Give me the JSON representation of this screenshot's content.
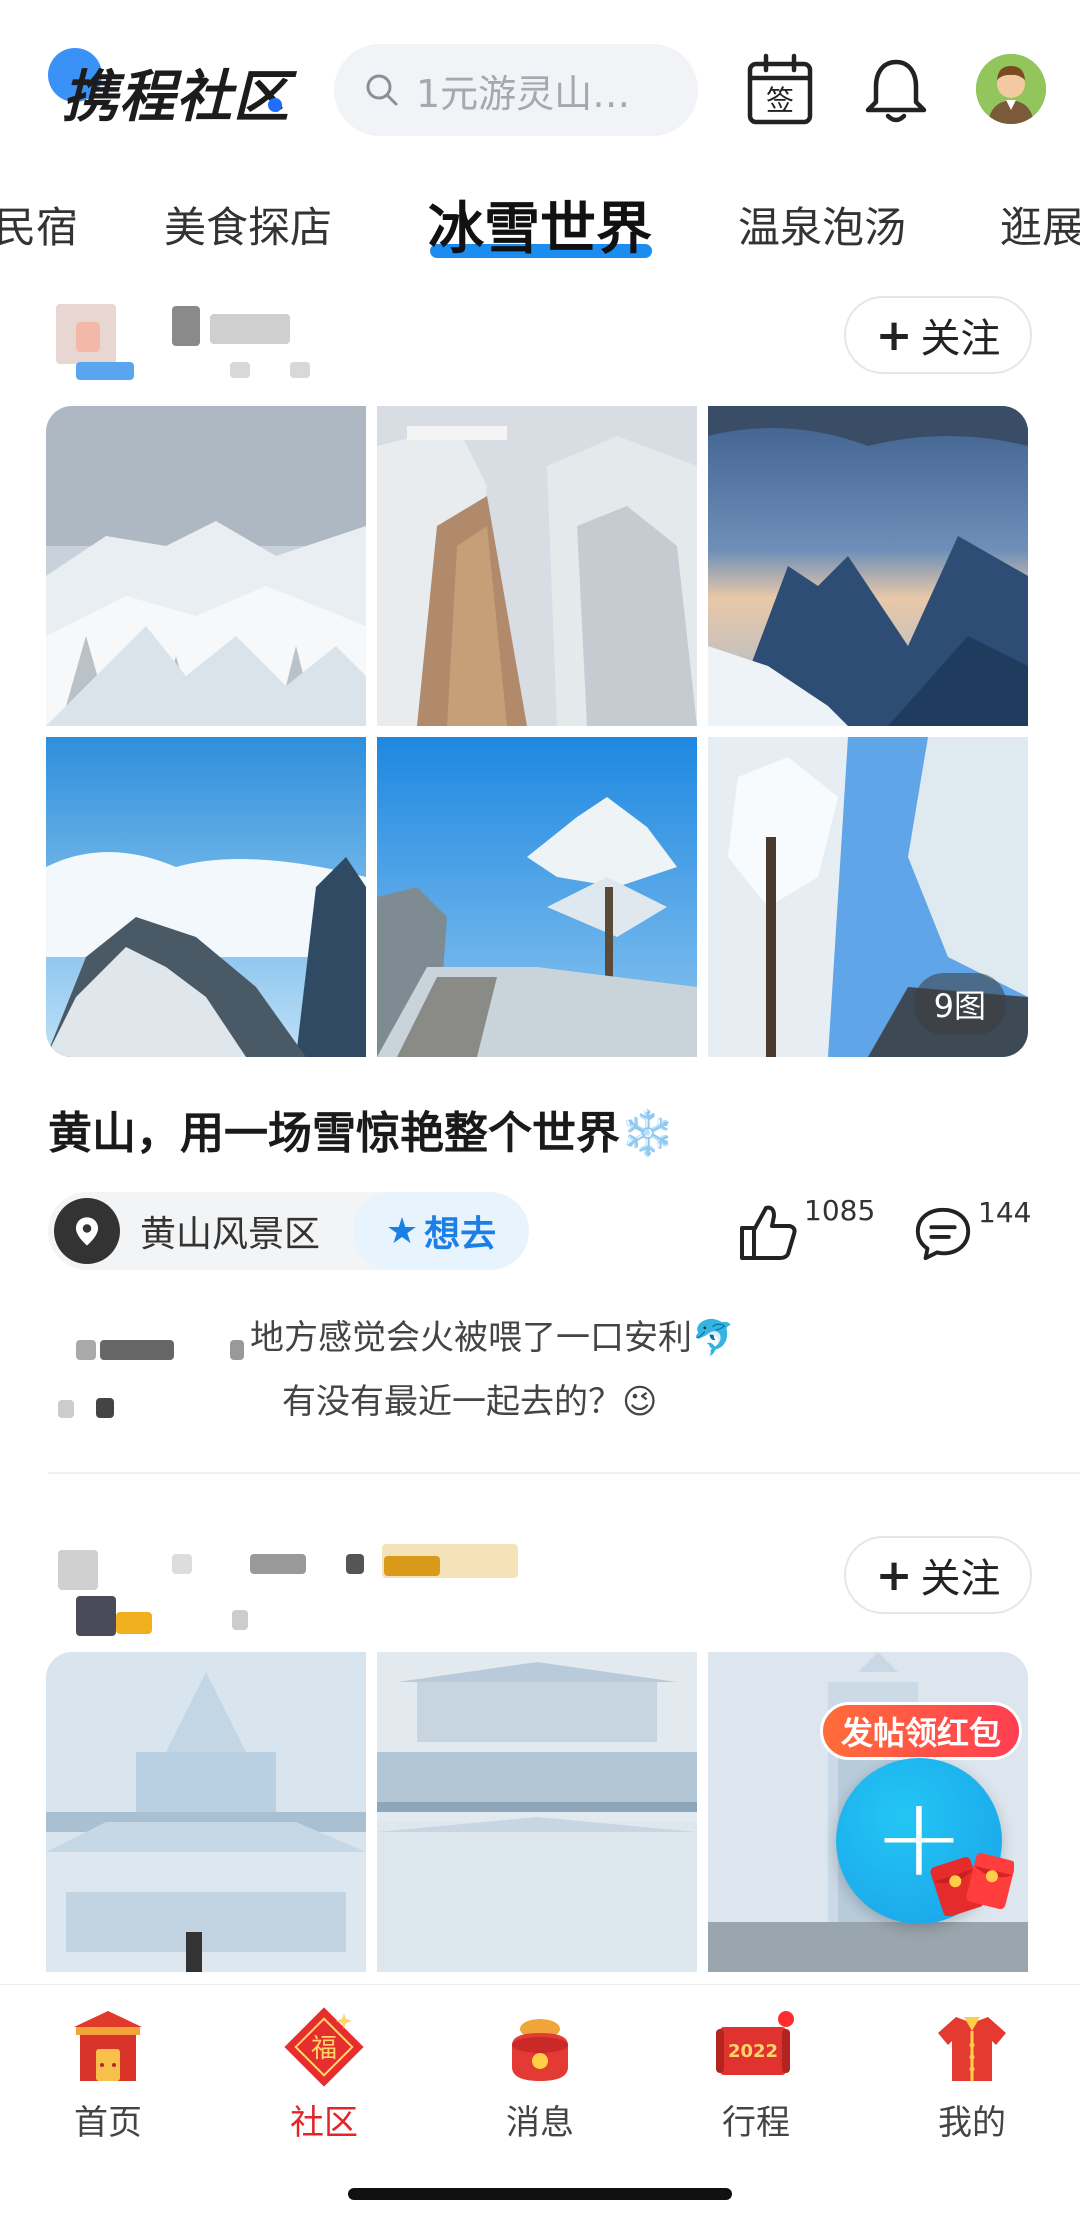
{
  "header": {
    "logo": "携程社区",
    "search_placeholder": "1元游灵山…",
    "sign_icon_text": "签"
  },
  "tabs": [
    "民宿",
    "美食探店",
    "冰雪世界",
    "温泉泡汤",
    "逛展"
  ],
  "active_tab": "冰雪世界",
  "post1": {
    "follow_label": "关注",
    "image_count": "9图",
    "title": "黄山，用一场雪惊艳整个世界❄️",
    "location": "黄山风景区",
    "want_label": "想去",
    "likes": "1085",
    "comments": "144",
    "comment_line1": "地方感觉会火被喂了一口安利🐬",
    "comment_line2": "有没有最近一起去的？😉"
  },
  "post2": {
    "follow_label": "关注"
  },
  "fab": {
    "tag": "发帖领红包",
    "plus": "+"
  },
  "bottom_nav": [
    {
      "label": "首页",
      "icon": "home-gate-icon",
      "active": false
    },
    {
      "label": "社区",
      "icon": "community-fu-icon",
      "active": true
    },
    {
      "label": "消息",
      "icon": "message-bag-icon",
      "active": false
    },
    {
      "label": "行程",
      "icon": "trip-2022-icon",
      "active": false
    },
    {
      "label": "我的",
      "icon": "profile-robe-icon",
      "active": false
    }
  ],
  "bottom_nav_2022": "2022",
  "community_fu": "福",
  "colors": {
    "accent_blue": "#1b8cf0",
    "active_red": "#e4242b",
    "fab_blue": "#1aa0e8"
  }
}
